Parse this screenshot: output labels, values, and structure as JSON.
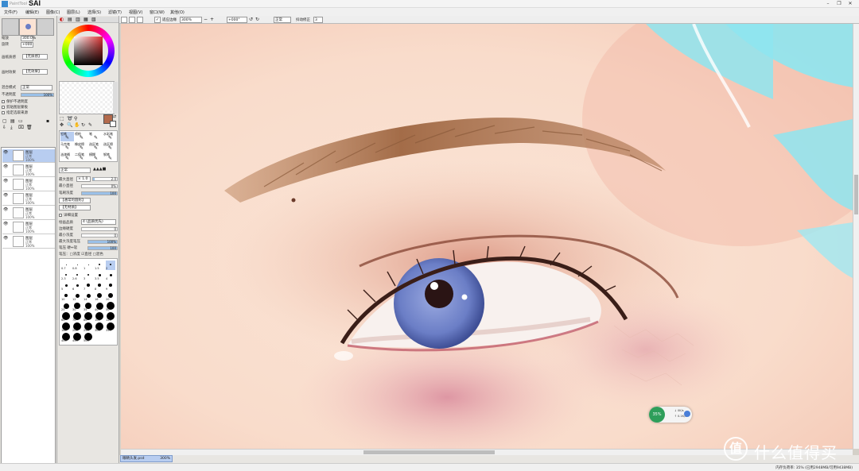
{
  "app": {
    "name": "SAI",
    "window_controls": [
      "–",
      "❐",
      "✕"
    ]
  },
  "menu": [
    "文件(F)",
    "编辑(E)",
    "图像(C)",
    "图层(L)",
    "选择(S)",
    "滤镜(T)",
    "视图(V)",
    "窗口(W)",
    "其他(O)"
  ],
  "canvas_toolbar": {
    "zoom_value": "300%",
    "angle_value": "+000°",
    "blend_mode": "正常",
    "stabilizer_label": "抖动修正",
    "stabilizer_value": "3"
  },
  "left_panel": {
    "zoom_label": "缩放",
    "zoom_value": "300.0%",
    "angle_label": "旋转",
    "angle_value": "+000",
    "paper_texture_label": "画纸质感",
    "paper_texture_value": "【无质感】",
    "paper_effect_label": "画材效果",
    "paper_effect_value": "【无效果】",
    "blend_label": "混合模式",
    "blend_value": "正常",
    "opacity_label": "不透明度",
    "opacity_value": "100%",
    "opacity_fraction": 1.0,
    "options": [
      "保护不透明度",
      "剪贴图层蒙板",
      "指定选取来源"
    ],
    "layers": [
      {
        "name": "图层",
        "mode": "正常",
        "pct": "100%",
        "selected": true
      },
      {
        "name": "图层",
        "mode": "正常",
        "pct": "100%",
        "selected": false
      },
      {
        "name": "图层",
        "mode": "正常",
        "pct": "100%",
        "selected": false
      },
      {
        "name": "图层",
        "mode": "正常",
        "pct": "100%",
        "selected": false
      },
      {
        "name": "图层",
        "mode": "正常",
        "pct": "100%",
        "selected": false
      },
      {
        "name": "图层",
        "mode": "正常",
        "pct": "100%",
        "selected": false
      },
      {
        "name": "图层",
        "mode": "正常",
        "pct": "100%",
        "selected": false
      }
    ]
  },
  "tools_panel": {
    "tool_names": [
      "铅笔",
      "喷枪",
      "笔",
      "水彩笔",
      "马克笔",
      "橡皮擦",
      "选区笔",
      "选区擦",
      "油漆桶",
      "二值笔",
      "模糊",
      "钢笔"
    ],
    "brush_mode": "正常",
    "max_size_label": "最大直径",
    "max_size_value": "× 1.0",
    "max_size_num": "2.0",
    "min_size_label": "最小直径",
    "min_size_value": "0%",
    "density_label": "笔刷浓度",
    "density_value": "100",
    "shape_value": "【通常的圆形】",
    "texture_value": "【无材质】",
    "detail_label": "详细设置",
    "quality_label": "绘画品质",
    "quality_value": "4 (品质优先)",
    "edge_label": "边缘硬度",
    "edge_value": "0",
    "min_density_label": "最小浓度",
    "min_density_value": "0",
    "max_pressure_label": "最大浓度笔压",
    "max_pressure_value": "100%",
    "pressure_label": "笔压 硬⇔软",
    "pressure_value": "100",
    "pressure_opts": "笔压：□浓度 ☑直径 □混色",
    "brush_sizes": [
      "0.7",
      "0.8",
      "1",
      "1.5",
      "2",
      "2.3",
      "2.6",
      "3",
      "3.5",
      "4",
      "5",
      "6",
      "7",
      "8",
      "9",
      "10",
      "12",
      "14",
      "16",
      "20",
      "25",
      "30",
      "35",
      "40",
      "50",
      "60",
      "70",
      "80",
      "100",
      "120",
      "160",
      "200",
      "250",
      "300",
      "350",
      "400",
      "450",
      "500"
    ]
  },
  "document": {
    "tab_name": "眼睛头发.psd",
    "tab_zoom": "300%"
  },
  "status": {
    "memory": "内存负荷率: 35% (已用2948MB/可用9438MB)"
  },
  "perf_widget": {
    "percent": "35%",
    "down": "↓ 0K/s",
    "up": "↑ 0.1K/s"
  },
  "watermark": {
    "glyph": "值",
    "text": "什么值得买"
  },
  "colors": {
    "skin": "#fbe3d4",
    "iris": "#6b7ec6",
    "brow": "#a97452",
    "hair_cyan": "#8ee5f0",
    "selected_blue": "#b8cdf0",
    "current_color": "#b36a4c"
  }
}
